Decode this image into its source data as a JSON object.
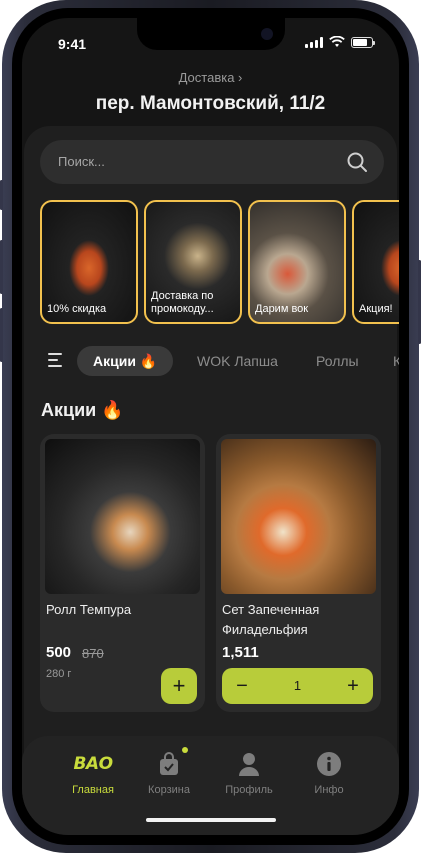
{
  "status": {
    "time": "9:41"
  },
  "header": {
    "delivery_label": "Доставка ›",
    "address": "пер. Мамонтовский, 11/2"
  },
  "search": {
    "placeholder": "Поиск..."
  },
  "stories": [
    {
      "caption": "10% скидка"
    },
    {
      "caption": "Доставка по промокоду..."
    },
    {
      "caption": "Дарим вок"
    },
    {
      "caption": "Акция!"
    }
  ],
  "categories": [
    {
      "label": "Акции 🔥",
      "active": true
    },
    {
      "label": "WOK Лапша"
    },
    {
      "label": "Роллы"
    },
    {
      "label": "К"
    }
  ],
  "section": {
    "title": "Акции 🔥"
  },
  "products": [
    {
      "name": "Ролл Темпура",
      "price": "500",
      "old_price": "870",
      "weight": "280 г",
      "add_label": "+"
    },
    {
      "name": "Сет Запеченная Филадельфия",
      "price": "1,511",
      "minus_label": "−",
      "quantity": "1",
      "plus_label": "+"
    }
  ],
  "tabbar": {
    "logo_text": "ВАО",
    "items": [
      {
        "label": "Главная",
        "active": true
      },
      {
        "label": "Корзина"
      },
      {
        "label": "Профиль"
      },
      {
        "label": "Инфо"
      }
    ]
  },
  "colors": {
    "accent": "#c9dc3c",
    "story_border": "#f2c14e",
    "background": "#151515",
    "card": "#2b2b2b"
  }
}
